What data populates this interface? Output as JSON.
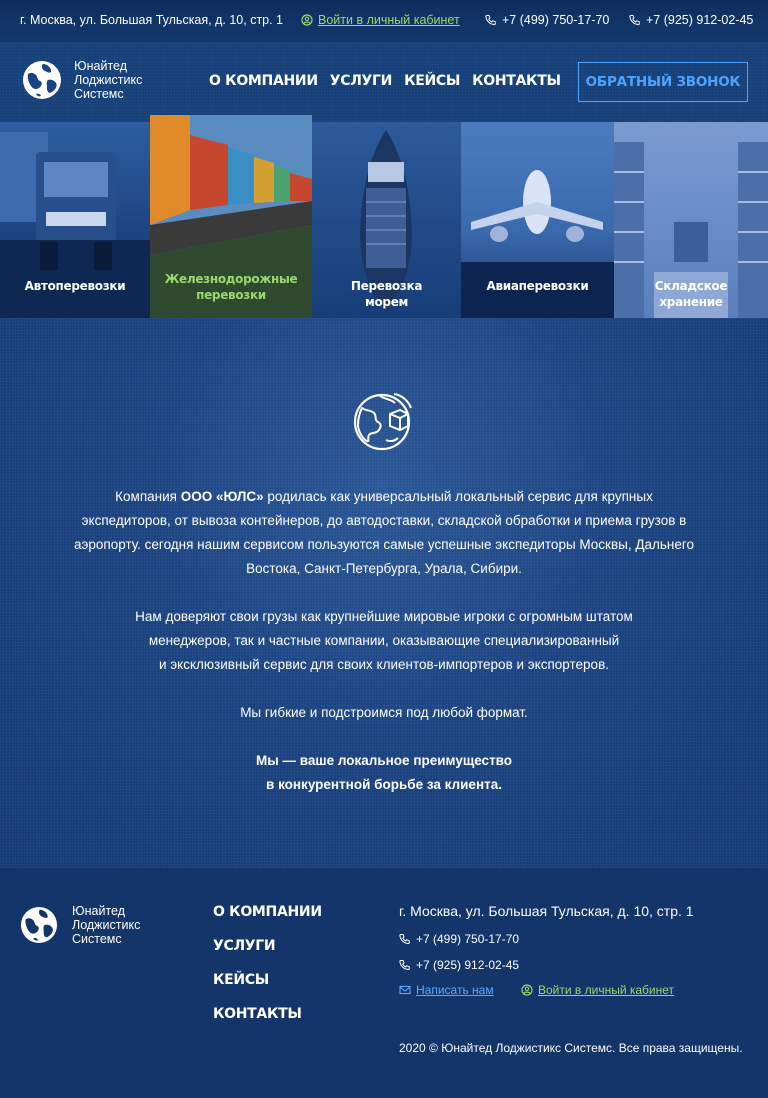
{
  "topbar": {
    "address": "г. Москва, ул. Большая Тульская, д. 10, стр. 1",
    "login_link": "Войти в личный кабинет",
    "phone1": "+7 (499) 750-17-70",
    "phone2": "+7 (925) 912-02-45"
  },
  "header": {
    "logo_line1": "Юнайтед",
    "logo_line2": "Лоджистикс",
    "logo_line3": "Системс",
    "nav": [
      "О КОМПАНИИ",
      "УСЛУГИ",
      "КЕЙСЫ",
      "КОНТАКТЫ"
    ],
    "callback_button": "ОБРАТНЫЙ ЗВОНОК"
  },
  "services": [
    {
      "line1": "Автоперевозки",
      "line2": ""
    },
    {
      "line1": "Железнодорожные",
      "line2": "перевозки"
    },
    {
      "line1": "Перевозка",
      "line2": "морем"
    },
    {
      "line1": "Авиаперевозки",
      "line2": ""
    },
    {
      "line1": "Складское",
      "line2": "хранение"
    }
  ],
  "main": {
    "p1_before": "Компания ",
    "p1_bold": "ООО «ЮЛС»",
    "p1_after": " родилась как универсальный локальный сервис для крупных экспедиторов, от вывоза контейнеров, до автодоставки, складской обработки и приема грузов в аэропорту. сегодня нашим сервисом пользуются самые успешные экспедиторы Москвы, Дальнего Востока, Санкт-Петербурга, Урала, Сибири.",
    "p2_line1": "Нам доверяют свои грузы как крупнейшие мировые игроки с огромным штатом",
    "p2_line2": "менеджеров, так и частные компании, оказывающие специализированный",
    "p2_line3": "и эксклюзивный сервис для своих клиентов-импортеров и экспортеров.",
    "p3": "Мы гибкие и подстроимся под любой формат.",
    "p4_line1": "Мы — ваше локальное преимущество",
    "p4_line2": "в конкурентной борьбе за клиента."
  },
  "footer": {
    "logo_line1": "Юнайтед",
    "logo_line2": "Лоджистикс",
    "logo_line3": "Системс",
    "nav": [
      "О КОМПАНИИ",
      "УСЛУГИ",
      "КЕЙСЫ",
      "КОНТАКТЫ"
    ],
    "address": "г. Москва, ул. Большая Тульская, д. 10, стр. 1",
    "phone1": "+7 (499) 750-17-70",
    "phone2": "+7 (925) 912-02-45",
    "write_link": "Написать нам",
    "login_link": "Войти в личный кабинет",
    "copyright": "2020 © Юнайтед Лоджистикс Системс. Все права защищены."
  },
  "colors": {
    "accent_green": "#9ad86e",
    "accent_blue": "#4ea3ff",
    "background": "#123567"
  },
  "icons": [
    "user-circle-icon",
    "phone-icon",
    "mail-icon",
    "globe-logo-icon",
    "globe-box-icon"
  ]
}
